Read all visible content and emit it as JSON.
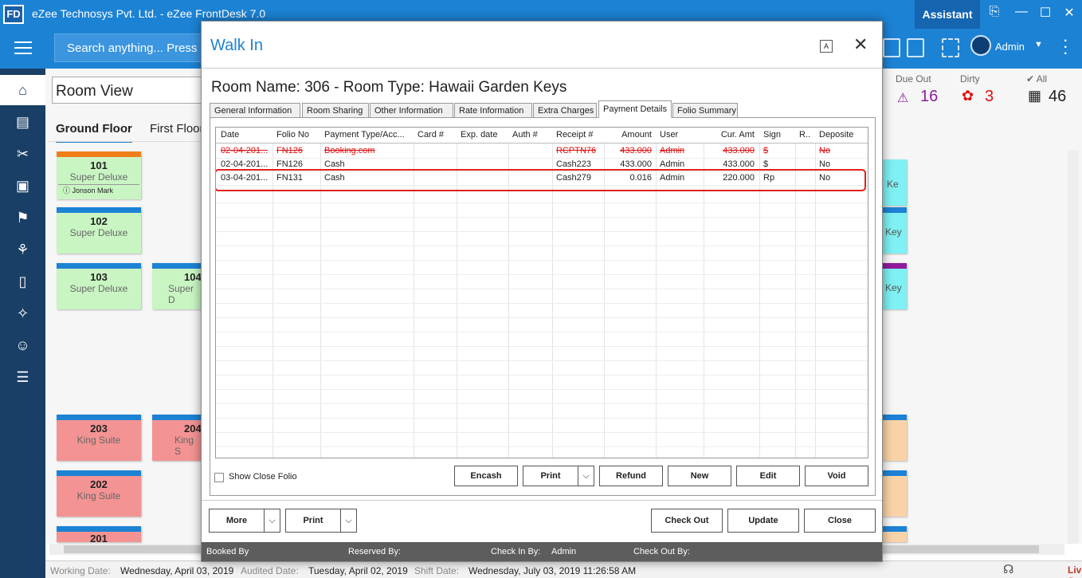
{
  "app": {
    "logo": "FD",
    "title": "eZee Technosys Pvt. Ltd. - eZee FrontDesk 7.0",
    "assistant_label": "Assistant",
    "minimize": "—",
    "maximize": "☐",
    "close": "✕"
  },
  "toolbar": {
    "search_placeholder": "Search anything... Press",
    "user_name": "Admin"
  },
  "room_view": {
    "view_select": "Room View",
    "floors": [
      "Ground Floor",
      "First Floor"
    ],
    "stats": {
      "due_out_label": "Due Out",
      "due_out_value": "16",
      "dirty_label": "Dirty",
      "dirty_value": "3",
      "all_label": "All",
      "all_value": "46"
    },
    "rooms": [
      {
        "num": "101",
        "type": "Super Deluxe",
        "guest": "Jonson Mark"
      },
      {
        "num": "102",
        "type": "Super Deluxe"
      },
      {
        "num": "103",
        "type": "Super Deluxe"
      },
      {
        "num": "104",
        "type": "Super D"
      },
      {
        "num": "203",
        "type": "King Suite"
      },
      {
        "num": "204",
        "type": "King S"
      },
      {
        "num": "202",
        "type": "King Suite"
      },
      {
        "num": "201",
        "type": ""
      }
    ],
    "right_partial": [
      "Ke",
      "Key",
      "Key"
    ]
  },
  "dialog": {
    "title": "Walk In",
    "room_name": "Room Name: 306 - Room Type: Hawaii Garden Keys",
    "tabs": [
      "General Information",
      "Room Sharing",
      "Other Information",
      "Rate Information",
      "Extra Charges",
      "Payment Details",
      "Folio Summary"
    ],
    "active_tab": "Payment Details",
    "columns": [
      "Date",
      "Folio No",
      "Payment Type/Acc...",
      "Card #",
      "Exp. date",
      "Auth #",
      "Receipt #",
      "Amount",
      "User",
      "Cur. Amt",
      "Sign",
      "R..",
      "Deposite"
    ],
    "rows": [
      {
        "date": "02-04-201...",
        "folio": "FN126",
        "payment_type": "Booking.com",
        "card": "",
        "exp": "",
        "auth": "",
        "receipt": "RCPTN76",
        "amount": "433.000",
        "user": "Admin",
        "cur_amt": "433.000",
        "sign": "$",
        "r": "",
        "deposite": "No",
        "voided": true
      },
      {
        "date": "02-04-201...",
        "folio": "FN126",
        "payment_type": "Cash",
        "card": "",
        "exp": "",
        "auth": "",
        "receipt": "Cash223",
        "amount": "433.000",
        "user": "Admin",
        "cur_amt": "433.000",
        "sign": "$",
        "r": "",
        "deposite": "No",
        "voided": false
      },
      {
        "date": "03-04-201...",
        "folio": "FN131",
        "payment_type": "Cash",
        "card": "",
        "exp": "",
        "auth": "",
        "receipt": "Cash279",
        "amount": "0.016",
        "user": "Admin",
        "cur_amt": "220.000",
        "sign": "Rp",
        "r": "",
        "deposite": "No",
        "voided": false
      }
    ],
    "show_close_folio": "Show Close Folio",
    "panel_buttons": {
      "encash": "Encash",
      "print": "Print",
      "refund": "Refund",
      "new": "New",
      "edit": "Edit",
      "void": "Void"
    },
    "footer_buttons": {
      "more": "More",
      "print": "Print",
      "check_out": "Check Out",
      "update": "Update",
      "close": "Close"
    },
    "bottom_bar": {
      "booked_by": "Booked By",
      "reserved_by": "Reserved By:",
      "check_in_by": "Check In By:",
      "check_in_by_value": "Admin",
      "check_out_by": "Check Out By:"
    }
  },
  "status_bar": {
    "working_date_label": "Working Date:",
    "working_date": "Wednesday, April 03, 2019",
    "audited_date_label": "Audited Date:",
    "audited_date": "Tuesday, April 02, 2019",
    "shift_date_label": "Shift Date:",
    "shift_date": "Wednesday, July 03, 2019 11:26:58 AM",
    "live_support": "Live Support"
  },
  "colors": {
    "brand_blue": "#1c82d4",
    "sidebar": "#1a3f66",
    "voided_red": "#dd1111",
    "highlight_red": "#e02020"
  }
}
